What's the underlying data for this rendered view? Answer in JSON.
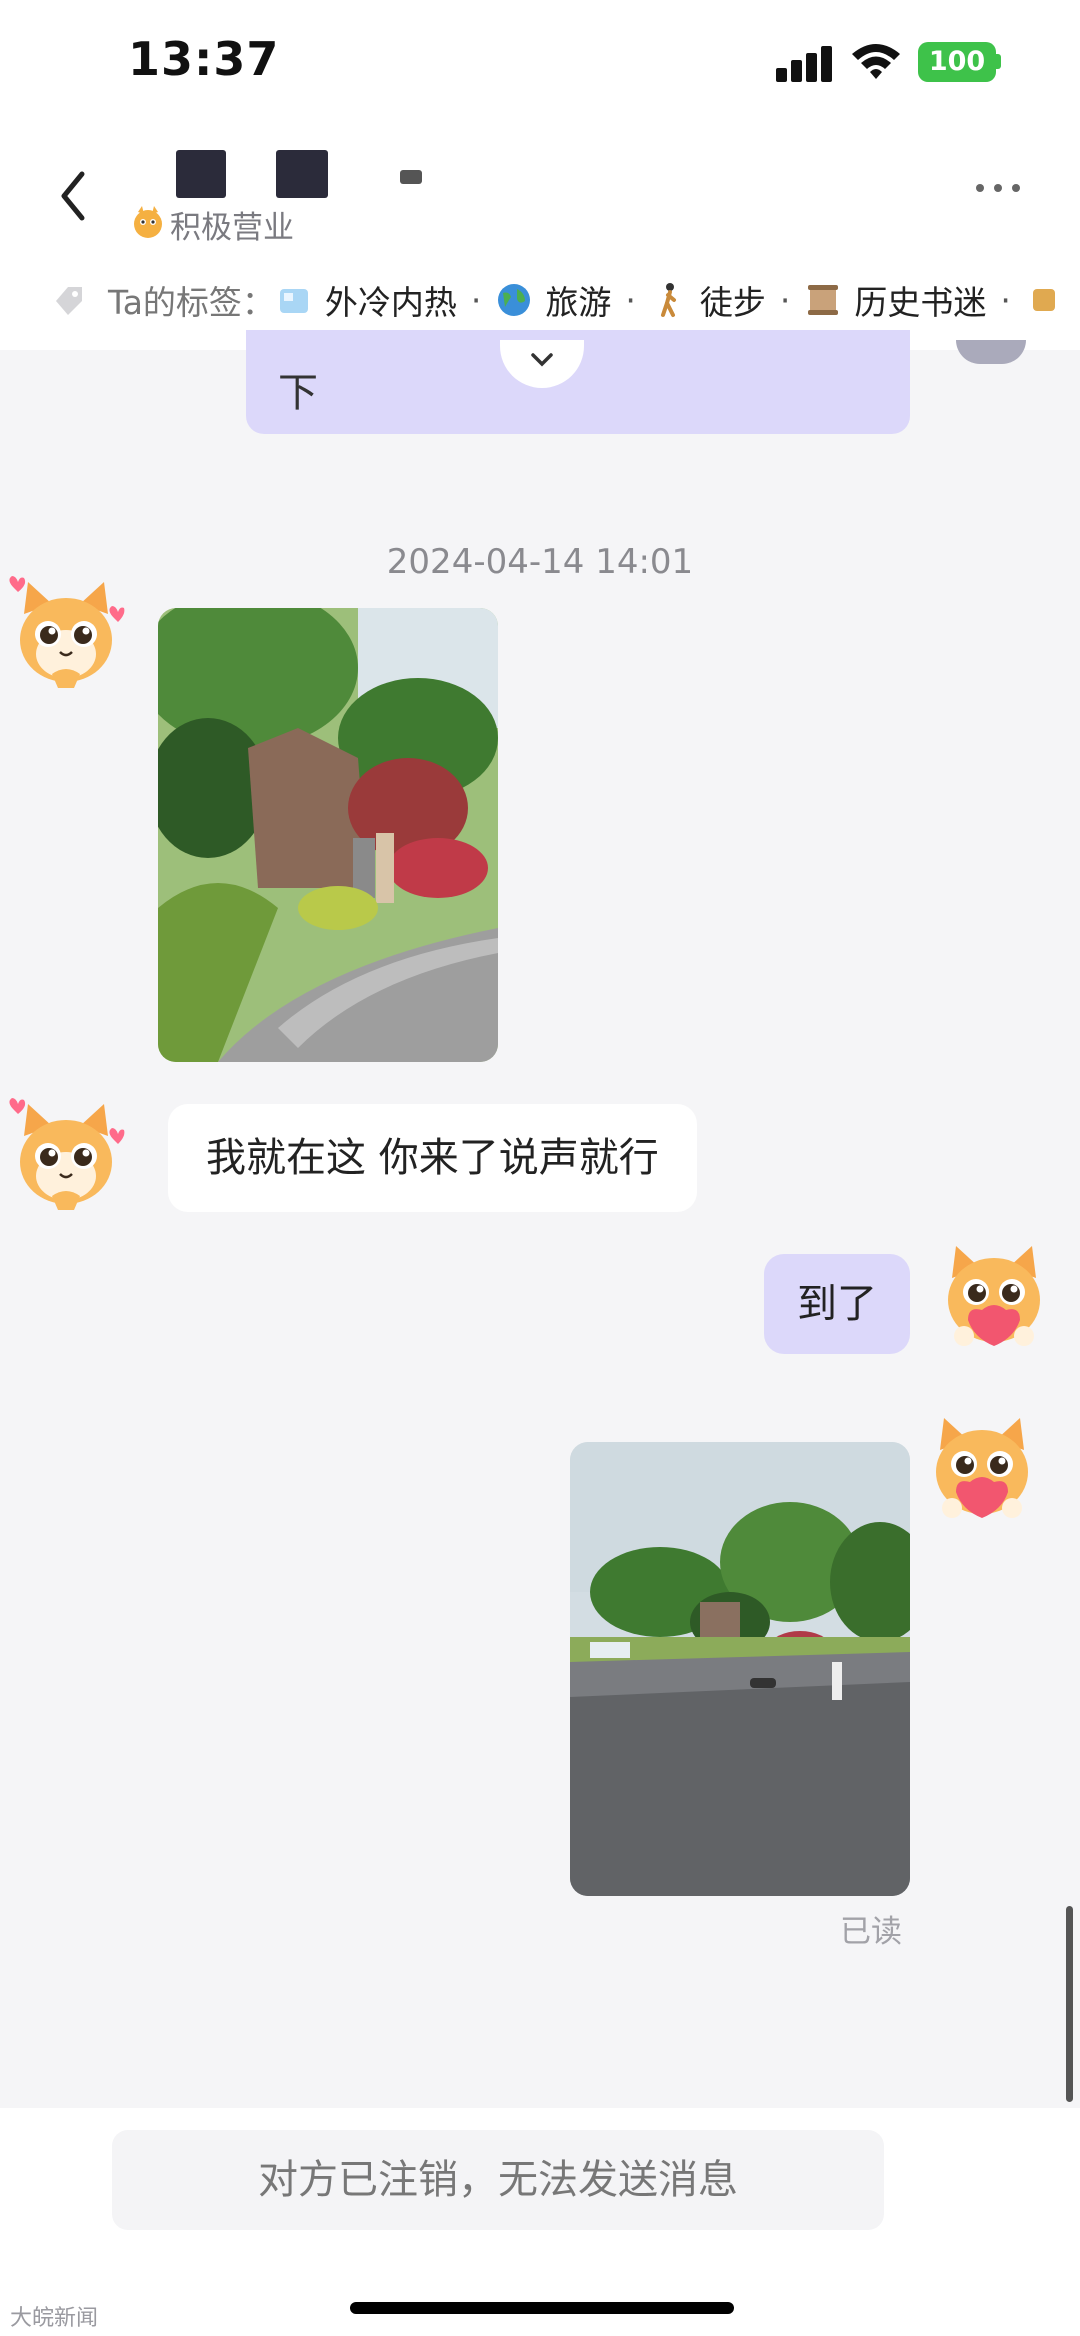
{
  "status_bar": {
    "time": "13:37",
    "battery": "100"
  },
  "header": {
    "contact_status": "积极营业",
    "tags_prefix": "Ta的标签：",
    "tags": [
      "外冷内热",
      "旅游",
      "徒步",
      "历史书迷"
    ]
  },
  "chat": {
    "truncated_message": "下",
    "timestamp": "2024-04-14 14:01",
    "message_left": "我就在这 你来了说声就行",
    "message_right": "到了",
    "read_receipt": "已读"
  },
  "footer": {
    "disabled_notice": "对方已注销，无法发送消息"
  },
  "watermark": "大皖新闻",
  "colors": {
    "bubble_self": "#dcd8fa",
    "bubble_other": "#ffffff",
    "battery": "#3ec24a",
    "background": "#f5f5f7"
  },
  "icons": [
    "back-icon",
    "more-icon",
    "tag-icon",
    "ice-cube-icon",
    "globe-icon",
    "walking-person-icon",
    "scroll-icon",
    "chevron-down-icon",
    "signal-icon",
    "wifi-icon",
    "battery-icon"
  ]
}
